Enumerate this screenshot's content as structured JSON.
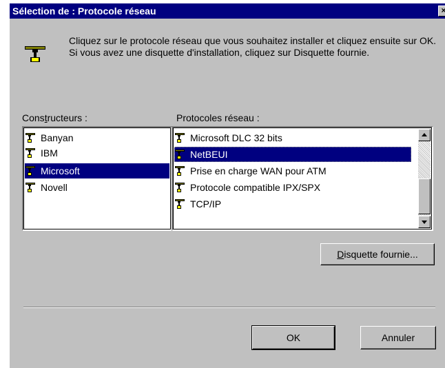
{
  "dialog": {
    "title": "Sélection de : Protocole réseau",
    "close_glyph": "×",
    "intro_text": "Cliquez sur le protocole réseau que vous souhaitez installer et cliquez ensuite sur OK. Si vous avez une disquette d'installation, cliquez sur Disquette fournie.",
    "intro_icon": "network-protocol-icon"
  },
  "manufacturers": {
    "label_pre": "Cons",
    "label_accel": "t",
    "label_post": "ructeurs :",
    "items": [
      {
        "label": "Banyan",
        "icon": "network-protocol-icon",
        "selected": false
      },
      {
        "label": "IBM",
        "icon": "network-protocol-icon",
        "selected": false
      },
      {
        "label": "Microsoft",
        "icon": "network-protocol-icon",
        "selected": true
      },
      {
        "label": "Novell",
        "icon": "network-protocol-icon",
        "selected": false
      }
    ]
  },
  "protocols": {
    "label": "Protocoles réseau :",
    "items": [
      {
        "label": "Microsoft DLC 32 bits",
        "icon": "network-protocol-icon",
        "selected": false
      },
      {
        "label": "NetBEUI",
        "icon": "network-protocol-icon",
        "selected": true
      },
      {
        "label": "Prise en charge WAN pour ATM",
        "icon": "network-protocol-icon",
        "selected": false
      },
      {
        "label": "Protocole compatible IPX/SPX",
        "icon": "network-protocol-icon",
        "selected": false
      },
      {
        "label": "TCP/IP",
        "icon": "network-protocol-icon",
        "selected": false
      }
    ]
  },
  "buttons": {
    "have_disk_accel": "D",
    "have_disk_rest": "isquette fournie...",
    "ok": "OK",
    "cancel": "Annuler"
  },
  "colors": {
    "title_bar": "#000080",
    "dialog_face": "#c0c0c0",
    "selection": "#000080"
  }
}
